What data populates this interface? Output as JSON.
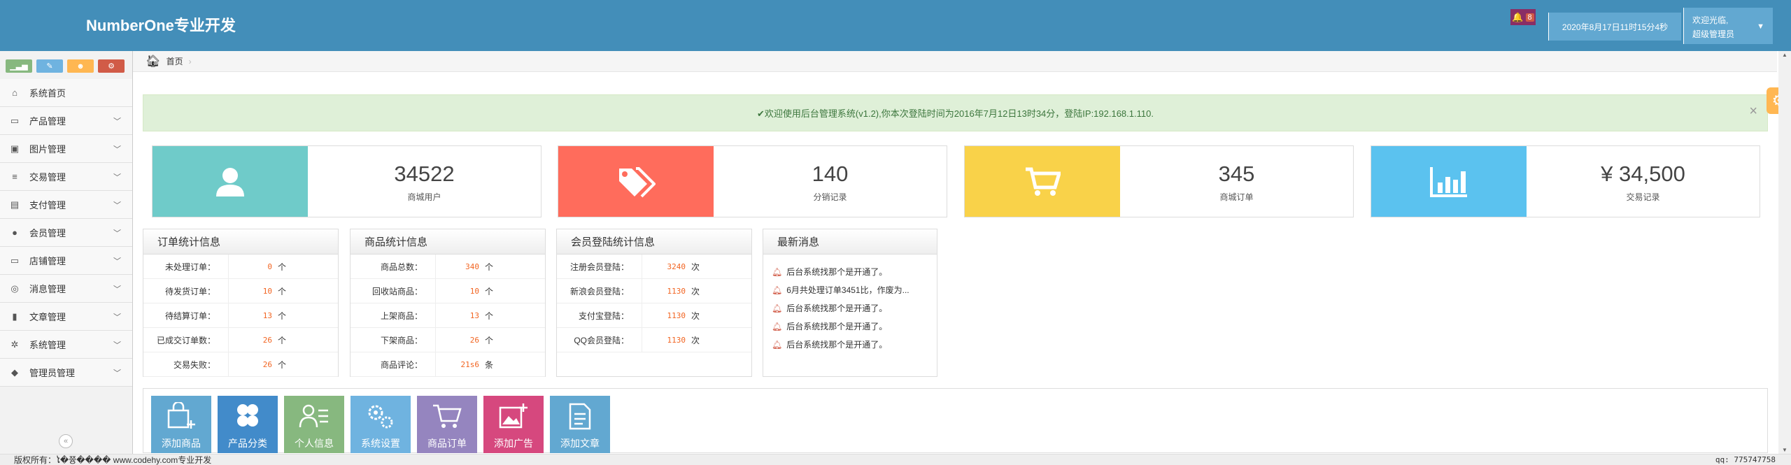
{
  "header": {
    "title": "NumberOne专业开发",
    "notif_count": "8",
    "datetime": "2020年8月17日11时15分4秒",
    "welcome": "欢迎光临,",
    "role": "超级管理员"
  },
  "sidebar": {
    "shortcuts": [
      {
        "icon": "signal-icon",
        "color": "#87b87f"
      },
      {
        "icon": "pencil-icon",
        "color": "#6fb3e0"
      },
      {
        "icon": "users-icon",
        "color": "#ffb752"
      },
      {
        "icon": "cogs-icon",
        "color": "#d15b47"
      }
    ],
    "items": [
      {
        "label": "系统首页",
        "icon": "home-icon",
        "glyph": "⌂"
      },
      {
        "label": "产品管理",
        "icon": "desktop-icon",
        "glyph": "▭"
      },
      {
        "label": "图片管理",
        "icon": "picture-icon",
        "glyph": "▣"
      },
      {
        "label": "交易管理",
        "icon": "list-icon",
        "glyph": "≡"
      },
      {
        "label": "支付管理",
        "icon": "credit-card-icon",
        "glyph": "▤"
      },
      {
        "label": "会员管理",
        "icon": "user-icon",
        "glyph": "●"
      },
      {
        "label": "店铺管理",
        "icon": "laptop-icon",
        "glyph": "▭"
      },
      {
        "label": "消息管理",
        "icon": "comments-icon",
        "glyph": "◎"
      },
      {
        "label": "文章管理",
        "icon": "bookmark-icon",
        "glyph": "▮"
      },
      {
        "label": "系统管理",
        "icon": "cogs-icon",
        "glyph": "✲"
      },
      {
        "label": "管理员管理",
        "icon": "group-icon",
        "glyph": "◆"
      }
    ]
  },
  "breadcrumb": {
    "home": "首页",
    "sep": "›"
  },
  "alert": {
    "text": "✔欢迎使用后台管理系统(v1.2),你本次登陆时间为2016年7月12日13时34分，登陆IP:192.168.1.110.",
    "close": "×"
  },
  "cards": [
    {
      "value": "34522",
      "label": "商城用户",
      "color": "#6fcbc9",
      "icon": "user-icon"
    },
    {
      "value": "140",
      "label": "分销记录",
      "color": "#ff6c5c",
      "icon": "tags-icon"
    },
    {
      "value": "345",
      "label": "商城订单",
      "color": "#f9d249",
      "icon": "cart-icon"
    },
    {
      "value": "¥ 34,500",
      "label": "交易记录",
      "color": "#5bc2ef",
      "icon": "bar-chart-icon"
    }
  ],
  "panels": {
    "orders": {
      "title": "订单统计信息",
      "rows": [
        {
          "k": "未处理订单：",
          "v": "0",
          "u": "个"
        },
        {
          "k": "待发货订单：",
          "v": "10",
          "u": "个"
        },
        {
          "k": "待结算订单：",
          "v": "13",
          "u": "个"
        },
        {
          "k": "已成交订单数：",
          "v": "26",
          "u": "个"
        },
        {
          "k": "交易失败：",
          "v": "26",
          "u": "个"
        }
      ]
    },
    "goods": {
      "title": "商品统计信息",
      "rows": [
        {
          "k": "商品总数：",
          "v": "340",
          "u": "个"
        },
        {
          "k": "回收站商品：",
          "v": "10",
          "u": "个"
        },
        {
          "k": "上架商品：",
          "v": "13",
          "u": "个"
        },
        {
          "k": "下架商品：",
          "v": "26",
          "u": "个"
        },
        {
          "k": "商品评论：",
          "v": "21s6",
          "u": "条"
        }
      ]
    },
    "members": {
      "title": "会员登陆统计信息",
      "rows": [
        {
          "k": "注册会员登陆：",
          "v": "3240",
          "u": "次"
        },
        {
          "k": "新浪会员登陆：",
          "v": "1130",
          "u": "次"
        },
        {
          "k": "支付宝登陆：",
          "v": "1130",
          "u": "次"
        },
        {
          "k": "QQ会员登陆：",
          "v": "1130",
          "u": "次"
        }
      ]
    },
    "news": {
      "title": "最新消息",
      "items": [
        "后台系统找那个是开通了。",
        "6月共处理订单3451比，作废为...",
        "后台系统找那个是开通了。",
        "后台系统找那个是开通了。",
        "后台系统找那个是开通了。"
      ]
    }
  },
  "quick": [
    {
      "label": "添加商品",
      "color": "#62a8d1",
      "icon": "bag-add-icon"
    },
    {
      "label": "产品分类",
      "color": "#428bca",
      "icon": "clover-icon"
    },
    {
      "label": "个人信息",
      "color": "#87b87f",
      "icon": "profile-icon"
    },
    {
      "label": "系统设置",
      "color": "#6fb3e0",
      "icon": "settings-icon"
    },
    {
      "label": "商品订单",
      "color": "#9585bf",
      "icon": "cart-icon"
    },
    {
      "label": "添加广告",
      "color": "#d6487e",
      "icon": "image-add-icon"
    },
    {
      "label": "添加文章",
      "color": "#62a8d1",
      "icon": "doc-icon"
    }
  ],
  "footer": {
    "left": "版权所有：ໄ�쯍���� www.codehy.com专业开发",
    "right": "qq: 775747758"
  }
}
